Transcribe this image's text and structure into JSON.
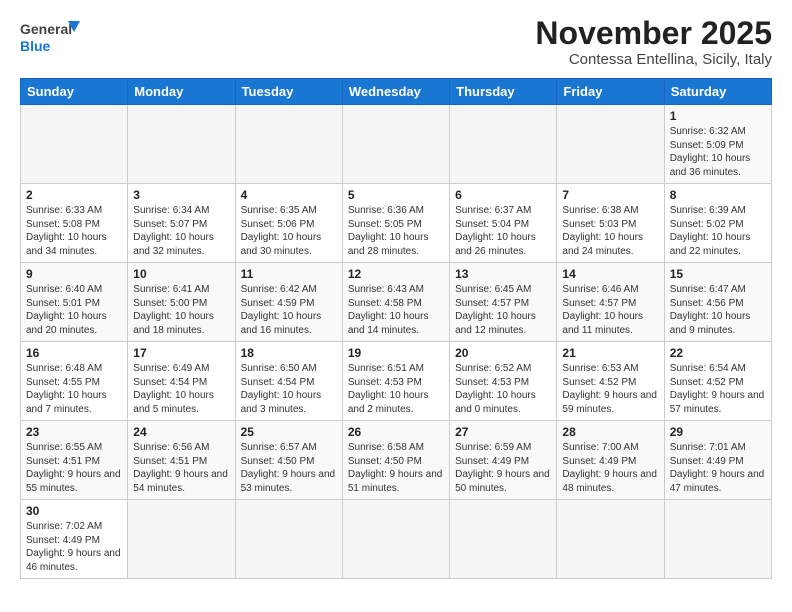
{
  "header": {
    "logo_general": "General",
    "logo_blue": "Blue",
    "month": "November 2025",
    "location": "Contessa Entellina, Sicily, Italy"
  },
  "days_of_week": [
    "Sunday",
    "Monday",
    "Tuesday",
    "Wednesday",
    "Thursday",
    "Friday",
    "Saturday"
  ],
  "weeks": [
    [
      {
        "day": "",
        "info": "",
        "empty": true
      },
      {
        "day": "",
        "info": "",
        "empty": true
      },
      {
        "day": "",
        "info": "",
        "empty": true
      },
      {
        "day": "",
        "info": "",
        "empty": true
      },
      {
        "day": "",
        "info": "",
        "empty": true
      },
      {
        "day": "",
        "info": "",
        "empty": true
      },
      {
        "day": "1",
        "info": "Sunrise: 6:32 AM\nSunset: 5:09 PM\nDaylight: 10 hours\nand 36 minutes.",
        "empty": false
      }
    ],
    [
      {
        "day": "2",
        "info": "Sunrise: 6:33 AM\nSunset: 5:08 PM\nDaylight: 10 hours\nand 34 minutes.",
        "empty": false
      },
      {
        "day": "3",
        "info": "Sunrise: 6:34 AM\nSunset: 5:07 PM\nDaylight: 10 hours\nand 32 minutes.",
        "empty": false
      },
      {
        "day": "4",
        "info": "Sunrise: 6:35 AM\nSunset: 5:06 PM\nDaylight: 10 hours\nand 30 minutes.",
        "empty": false
      },
      {
        "day": "5",
        "info": "Sunrise: 6:36 AM\nSunset: 5:05 PM\nDaylight: 10 hours\nand 28 minutes.",
        "empty": false
      },
      {
        "day": "6",
        "info": "Sunrise: 6:37 AM\nSunset: 5:04 PM\nDaylight: 10 hours\nand 26 minutes.",
        "empty": false
      },
      {
        "day": "7",
        "info": "Sunrise: 6:38 AM\nSunset: 5:03 PM\nDaylight: 10 hours\nand 24 minutes.",
        "empty": false
      },
      {
        "day": "8",
        "info": "Sunrise: 6:39 AM\nSunset: 5:02 PM\nDaylight: 10 hours\nand 22 minutes.",
        "empty": false
      }
    ],
    [
      {
        "day": "9",
        "info": "Sunrise: 6:40 AM\nSunset: 5:01 PM\nDaylight: 10 hours\nand 20 minutes.",
        "empty": false
      },
      {
        "day": "10",
        "info": "Sunrise: 6:41 AM\nSunset: 5:00 PM\nDaylight: 10 hours\nand 18 minutes.",
        "empty": false
      },
      {
        "day": "11",
        "info": "Sunrise: 6:42 AM\nSunset: 4:59 PM\nDaylight: 10 hours\nand 16 minutes.",
        "empty": false
      },
      {
        "day": "12",
        "info": "Sunrise: 6:43 AM\nSunset: 4:58 PM\nDaylight: 10 hours\nand 14 minutes.",
        "empty": false
      },
      {
        "day": "13",
        "info": "Sunrise: 6:45 AM\nSunset: 4:57 PM\nDaylight: 10 hours\nand 12 minutes.",
        "empty": false
      },
      {
        "day": "14",
        "info": "Sunrise: 6:46 AM\nSunset: 4:57 PM\nDaylight: 10 hours\nand 11 minutes.",
        "empty": false
      },
      {
        "day": "15",
        "info": "Sunrise: 6:47 AM\nSunset: 4:56 PM\nDaylight: 10 hours\nand 9 minutes.",
        "empty": false
      }
    ],
    [
      {
        "day": "16",
        "info": "Sunrise: 6:48 AM\nSunset: 4:55 PM\nDaylight: 10 hours\nand 7 minutes.",
        "empty": false
      },
      {
        "day": "17",
        "info": "Sunrise: 6:49 AM\nSunset: 4:54 PM\nDaylight: 10 hours\nand 5 minutes.",
        "empty": false
      },
      {
        "day": "18",
        "info": "Sunrise: 6:50 AM\nSunset: 4:54 PM\nDaylight: 10 hours\nand 3 minutes.",
        "empty": false
      },
      {
        "day": "19",
        "info": "Sunrise: 6:51 AM\nSunset: 4:53 PM\nDaylight: 10 hours\nand 2 minutes.",
        "empty": false
      },
      {
        "day": "20",
        "info": "Sunrise: 6:52 AM\nSunset: 4:53 PM\nDaylight: 10 hours\nand 0 minutes.",
        "empty": false
      },
      {
        "day": "21",
        "info": "Sunrise: 6:53 AM\nSunset: 4:52 PM\nDaylight: 9 hours\nand 59 minutes.",
        "empty": false
      },
      {
        "day": "22",
        "info": "Sunrise: 6:54 AM\nSunset: 4:52 PM\nDaylight: 9 hours\nand 57 minutes.",
        "empty": false
      }
    ],
    [
      {
        "day": "23",
        "info": "Sunrise: 6:55 AM\nSunset: 4:51 PM\nDaylight: 9 hours\nand 55 minutes.",
        "empty": false
      },
      {
        "day": "24",
        "info": "Sunrise: 6:56 AM\nSunset: 4:51 PM\nDaylight: 9 hours\nand 54 minutes.",
        "empty": false
      },
      {
        "day": "25",
        "info": "Sunrise: 6:57 AM\nSunset: 4:50 PM\nDaylight: 9 hours\nand 53 minutes.",
        "empty": false
      },
      {
        "day": "26",
        "info": "Sunrise: 6:58 AM\nSunset: 4:50 PM\nDaylight: 9 hours\nand 51 minutes.",
        "empty": false
      },
      {
        "day": "27",
        "info": "Sunrise: 6:59 AM\nSunset: 4:49 PM\nDaylight: 9 hours\nand 50 minutes.",
        "empty": false
      },
      {
        "day": "28",
        "info": "Sunrise: 7:00 AM\nSunset: 4:49 PM\nDaylight: 9 hours\nand 48 minutes.",
        "empty": false
      },
      {
        "day": "29",
        "info": "Sunrise: 7:01 AM\nSunset: 4:49 PM\nDaylight: 9 hours\nand 47 minutes.",
        "empty": false
      }
    ],
    [
      {
        "day": "30",
        "info": "Sunrise: 7:02 AM\nSunset: 4:49 PM\nDaylight: 9 hours\nand 46 minutes.",
        "empty": false
      },
      {
        "day": "",
        "info": "",
        "empty": true
      },
      {
        "day": "",
        "info": "",
        "empty": true
      },
      {
        "day": "",
        "info": "",
        "empty": true
      },
      {
        "day": "",
        "info": "",
        "empty": true
      },
      {
        "day": "",
        "info": "",
        "empty": true
      },
      {
        "day": "",
        "info": "",
        "empty": true
      }
    ]
  ]
}
